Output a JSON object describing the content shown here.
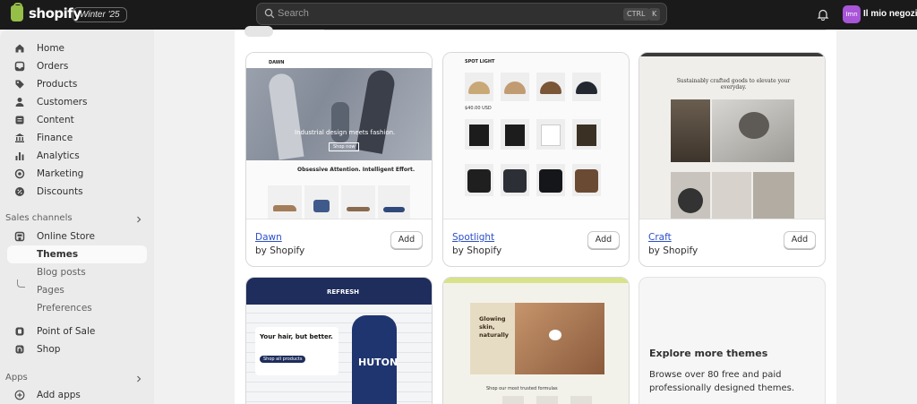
{
  "topbar": {
    "logo_text": "shopify",
    "badge": "Winter '25",
    "search_placeholder": "Search",
    "shortcut_keys": [
      "CTRL",
      "K"
    ],
    "avatar_initials": "Imn",
    "store_name": "Il mio negozio"
  },
  "sidebar": {
    "nav": [
      {
        "label": "Home",
        "icon": "home-icon"
      },
      {
        "label": "Orders",
        "icon": "inbox-icon"
      },
      {
        "label": "Products",
        "icon": "tag-icon"
      },
      {
        "label": "Customers",
        "icon": "person-icon"
      },
      {
        "label": "Content",
        "icon": "document-icon"
      },
      {
        "label": "Finance",
        "icon": "bank-icon"
      },
      {
        "label": "Analytics",
        "icon": "bar-chart-icon"
      },
      {
        "label": "Marketing",
        "icon": "target-icon"
      },
      {
        "label": "Discounts",
        "icon": "discount-icon"
      }
    ],
    "sales_channels_label": "Sales channels",
    "online_store": "Online Store",
    "sub_items": [
      "Themes",
      "Blog posts",
      "Pages",
      "Preferences"
    ],
    "point_of_sale": "Point of Sale",
    "shop": "Shop",
    "apps_label": "Apps",
    "add_apps": "Add apps"
  },
  "themes": [
    {
      "name": "Dawn",
      "by": "by Shopify",
      "add": "Add"
    },
    {
      "name": "Spotlight",
      "by": "by Shopify",
      "add": "Add"
    },
    {
      "name": "Craft",
      "by": "by Shopify",
      "add": "Add"
    }
  ],
  "previews": {
    "dawn": {
      "logo": "DAWN",
      "hero": "Industrial design meets fashion.",
      "cta": "Shop now",
      "section": "Obsessive Attention. Intelligent Effort."
    },
    "spotlight": {
      "logo": "SPOT LIGHT",
      "price": "$40.00 USD"
    },
    "craft": {
      "headline": "Sustainably crafted goods to elevate your everyday."
    },
    "refresh": {
      "logo": "REFRESH",
      "hero": "Your hair, but better.",
      "cta": "Shop all products",
      "bottle": "HUTON"
    },
    "glow": {
      "hero": "Glowing skin, naturally",
      "section": "Shop our most trusted formulas"
    }
  },
  "explore": {
    "title": "Explore more themes",
    "description": "Browse over 80 free and paid professionally designed themes."
  },
  "colors": {
    "topbar": "#1a1a1a",
    "accent_link": "#2c4fc9",
    "avatar": "#a855d8"
  }
}
